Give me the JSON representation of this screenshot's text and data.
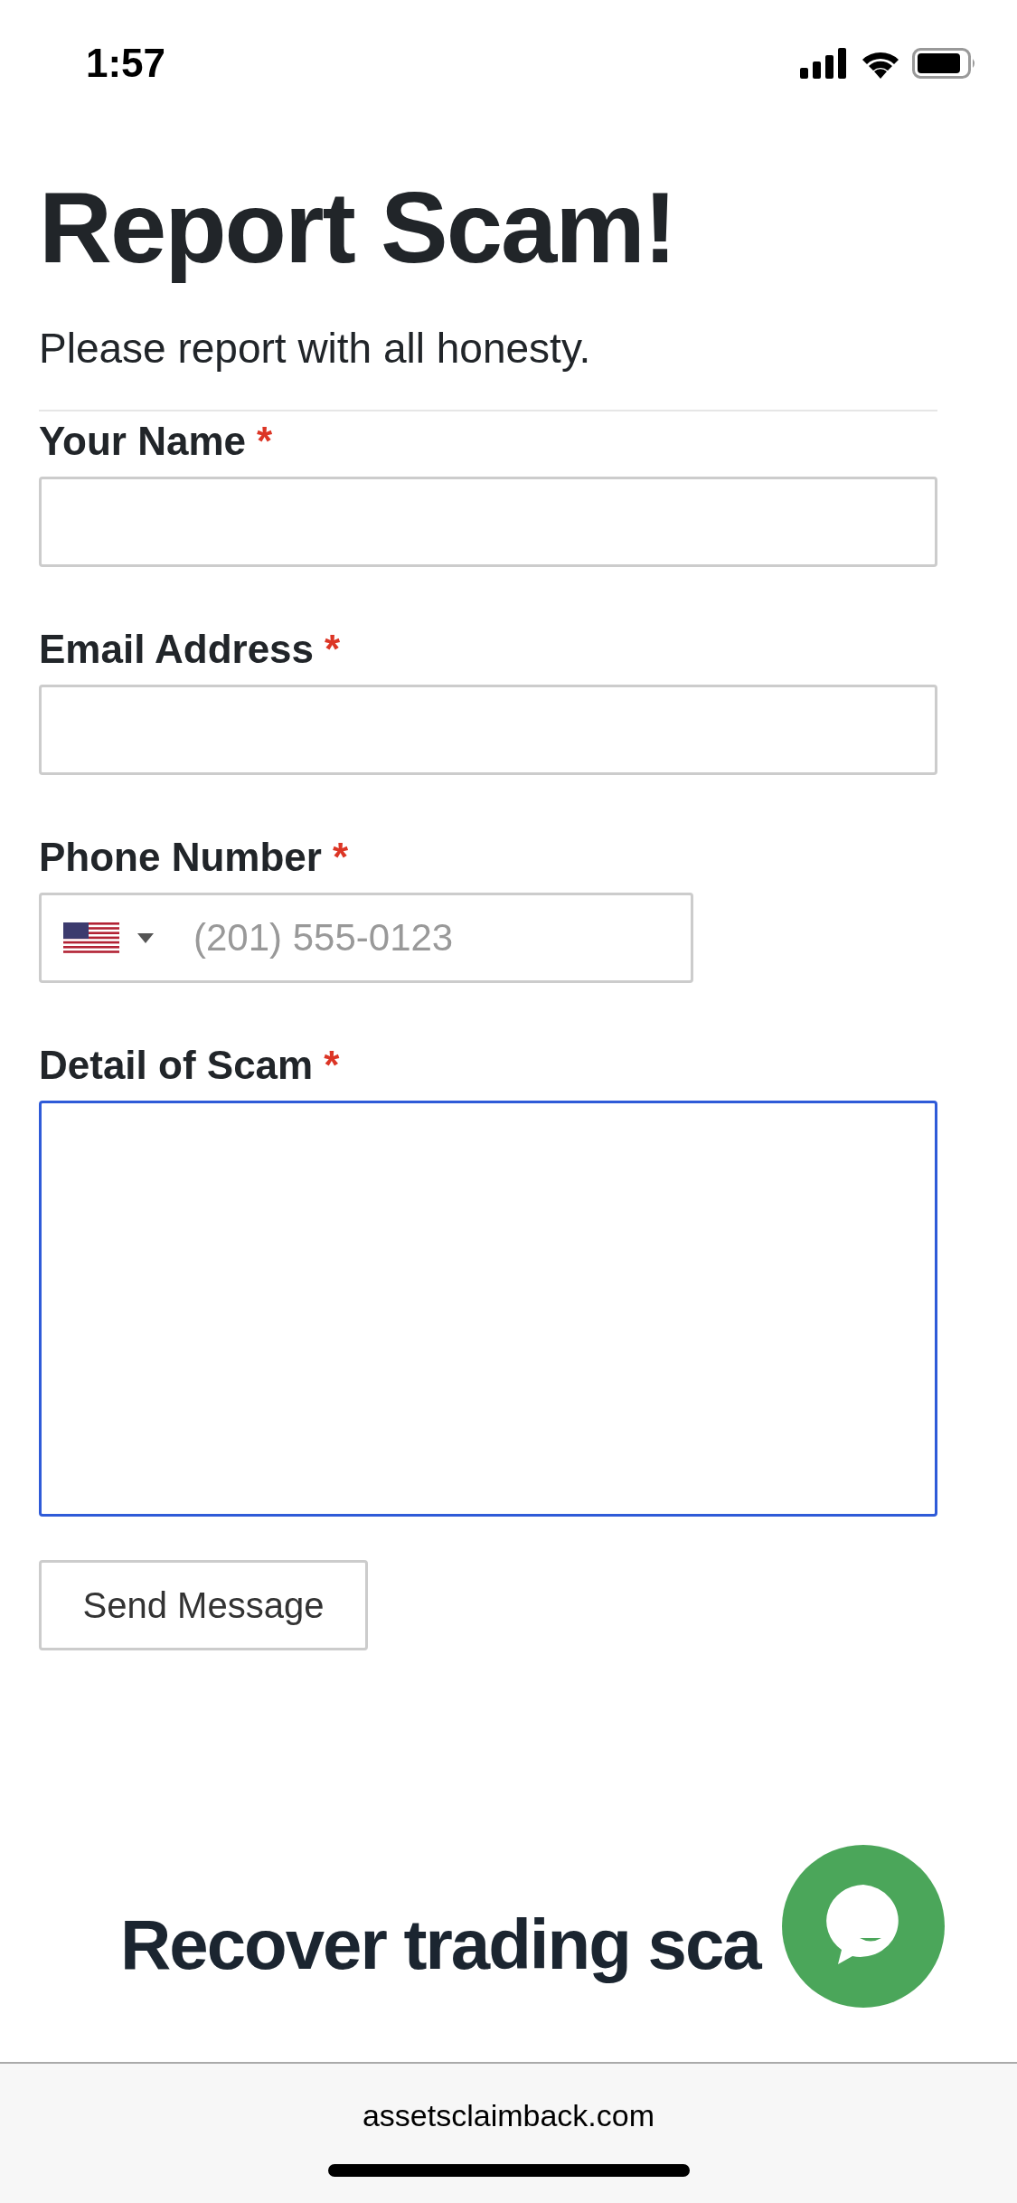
{
  "status_bar": {
    "time": "1:57"
  },
  "title": "Report Scam!",
  "subtitle": "Please report with all honesty.",
  "fields": [
    {
      "kind": "text",
      "label": "Your Name",
      "required_mark": "*",
      "focused": false
    },
    {
      "kind": "text",
      "label": "Email Address",
      "required_mark": "*",
      "focused": false
    },
    {
      "kind": "phone",
      "label": "Phone Number",
      "required_mark": "*",
      "placeholder": "(201) 555-0123",
      "focused": false
    },
    {
      "kind": "textarea",
      "label": "Detail of Scam",
      "required_mark": "*",
      "focused": true
    }
  ],
  "submit_button": "Send Message",
  "section_heading": "Recover trading sca",
  "browser_bar": {
    "url": "assetsclaimback.com"
  }
}
